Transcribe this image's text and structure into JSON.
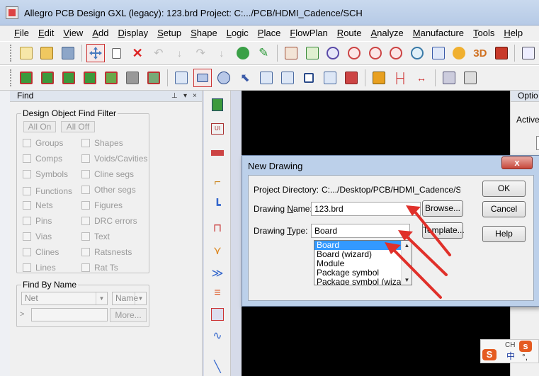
{
  "window": {
    "title": "Allegro PCB Design GXL (legacy): 123.brd  Project: C:.../PCB/HDMI_Cadence/SCH"
  },
  "menu": [
    "File",
    "Edit",
    "View",
    "Add",
    "Display",
    "Setup",
    "Shape",
    "Logic",
    "Place",
    "FlowPlan",
    "Route",
    "Analyze",
    "Manufacture",
    "Tools",
    "Help"
  ],
  "find_panel": {
    "title": "Find",
    "pin": "⊥",
    "dropdown": "▾",
    "close": "×",
    "filter_title": "Design Object Find Filter",
    "all_on": "All On",
    "all_off": "All Off",
    "left_items": [
      "Groups",
      "Comps",
      "Symbols",
      "Functions",
      "Nets",
      "Pins",
      "Vias",
      "Clines",
      "Lines"
    ],
    "right_items": [
      "Shapes",
      "Voids/Cavities",
      "Cline segs",
      "Other segs",
      "Figures",
      "DRC errors",
      "Text",
      "Ratsnests",
      "Rat Ts"
    ],
    "find_by_name_title": "Find By Name",
    "type_combo": "Net",
    "name_combo": "Name",
    "more_button": "More...",
    "expand": ">"
  },
  "right_panel": {
    "title": "Optio",
    "active": "Active"
  },
  "dialog": {
    "title": "New Drawing",
    "close": "x",
    "project_directory_label": "Project Directory:",
    "project_directory_value": "C:.../Desktop/PCB/HDMI_Cadence/SCH",
    "drawing_name_label_pre": "Drawing ",
    "drawing_name_label_u": "N",
    "drawing_name_label_post": "ame:",
    "drawing_name_value": "123.brd",
    "browse": "Browse...",
    "drawing_type_label_pre": "Drawing ",
    "drawing_type_label_u": "T",
    "drawing_type_label_post": "ype:",
    "drawing_type_value": "Board",
    "template": "Template...",
    "ok": "OK",
    "cancel": "Cancel",
    "help": "Help",
    "type_options": [
      "Board",
      "Board (wizard)",
      "Module",
      "Package symbol",
      "Package symbol (wizard)"
    ],
    "selected_option": "Board"
  },
  "ime": {
    "label": "CH",
    "text1": "中",
    "text2": "°,"
  },
  "colors": {
    "annotation_arrow": "#e0302a",
    "selection": "#3399ff",
    "canvas": "#000000"
  }
}
